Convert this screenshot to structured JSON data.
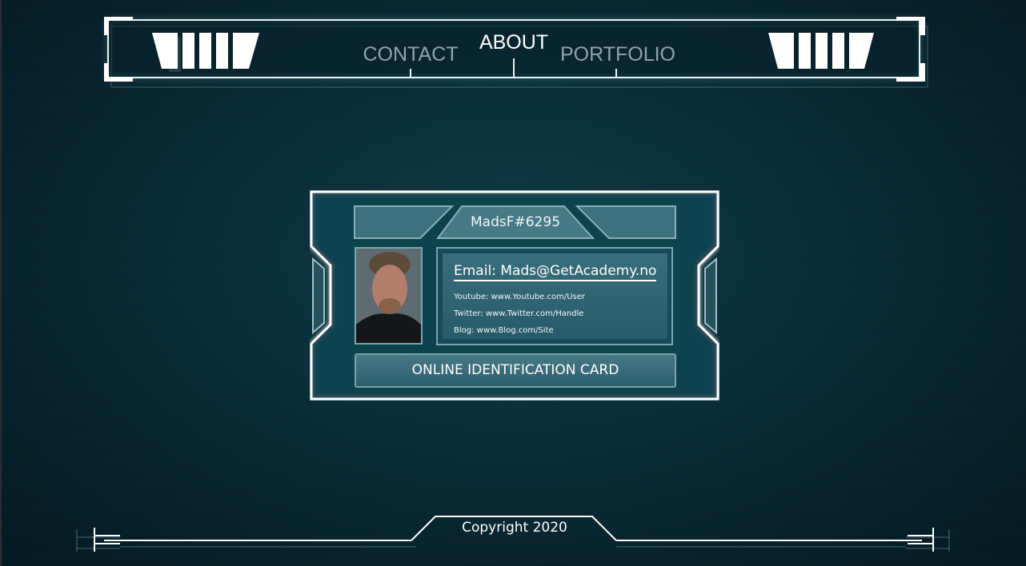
{
  "nav": {
    "contact": "CONTACT",
    "about": "ABOUT",
    "portfolio": "PORTFOLIO"
  },
  "card": {
    "username": "MadsF#6295",
    "email": "Email: Mads@GetAcademy.no",
    "youtube": "Youtube: www.Youtube.com/User",
    "twitter": "Twitter: www.Twitter.com/Handle",
    "blog": "Blog: www.Blog.com/Site",
    "caption": "ONLINE IDENTIFICATION CARD"
  },
  "footer": {
    "copyright": "Copyright 2020"
  },
  "colors": {
    "background": "#0b2e3a",
    "frame": "#ffffff",
    "panel_border": "#7aa3ad",
    "nav_inactive": "#8fa4a9",
    "nav_active": "#ffffff"
  }
}
